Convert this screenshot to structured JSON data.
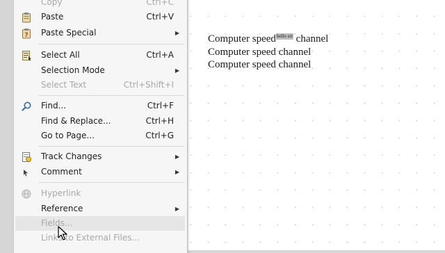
{
  "document": {
    "lines": [
      {
        "before": "Computer speed",
        "field": "hello sir",
        "after": "channel"
      },
      {
        "text": "Computer speed channel"
      },
      {
        "text": "Computer speed channel"
      }
    ]
  },
  "menu": {
    "copy": {
      "label": "Copy",
      "accel": "Ctrl+C"
    },
    "paste": {
      "label": "Paste",
      "accel": "Ctrl+V"
    },
    "paste_special": {
      "label": "Paste Special"
    },
    "select_all": {
      "label": "Select All",
      "accel": "Ctrl+A"
    },
    "selection_mode": {
      "label": "Selection Mode"
    },
    "select_text": {
      "label": "Select Text",
      "accel": "Ctrl+Shift+I"
    },
    "find": {
      "label": "Find...",
      "accel": "Ctrl+F"
    },
    "find_replace": {
      "label": "Find & Replace...",
      "accel": "Ctrl+H"
    },
    "goto_page": {
      "label": "Go to Page...",
      "accel": "Ctrl+G"
    },
    "track_changes": {
      "label": "Track Changes"
    },
    "comment": {
      "label": "Comment"
    },
    "hyperlink": {
      "label": "Hyperlink"
    },
    "reference": {
      "label": "Reference"
    },
    "fields": {
      "label": "Fields..."
    },
    "links_external": {
      "label": "Links to External Files..."
    }
  },
  "icons": {
    "paste": "clipboard-icon",
    "paste_special": "clipboard-special-icon",
    "select_all": "select-all-icon",
    "find": "magnifier-icon",
    "track_changes": "track-changes-icon",
    "comment": "comment-icon",
    "hyperlink": "globe-icon"
  },
  "colors": {
    "menu_bg": "#f6f6f6",
    "hover_bg": "#e6e6e6",
    "disabled_text": "#a8a8a8",
    "field_shading": "#bdbdbd"
  }
}
